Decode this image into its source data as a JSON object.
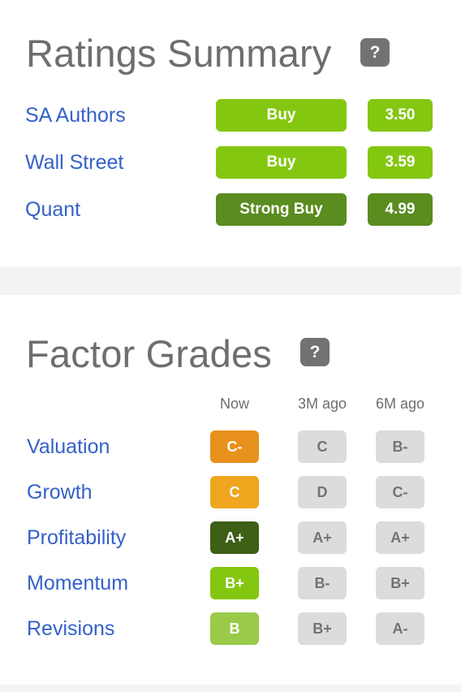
{
  "ratings_summary": {
    "title": "Ratings Summary",
    "help_icon": "question-icon",
    "rows": [
      {
        "label": "SA Authors",
        "rating": "Buy",
        "score": "3.50",
        "color": "#84c711"
      },
      {
        "label": "Wall Street",
        "rating": "Buy",
        "score": "3.59",
        "color": "#84c711"
      },
      {
        "label": "Quant",
        "rating": "Strong Buy",
        "score": "4.99",
        "color": "#5a8c1f"
      }
    ]
  },
  "factor_grades": {
    "title": "Factor Grades",
    "help_icon": "question-icon",
    "columns": [
      "Now",
      "3M ago",
      "6M ago"
    ],
    "rows": [
      {
        "label": "Valuation",
        "now": "C-",
        "now_color": "#e8911c",
        "m3": "C",
        "m6": "B-"
      },
      {
        "label": "Growth",
        "now": "C",
        "now_color": "#efa61e",
        "m3": "D",
        "m6": "C-"
      },
      {
        "label": "Profitability",
        "now": "A+",
        "now_color": "#3d5f16",
        "m3": "A+",
        "m6": "A+"
      },
      {
        "label": "Momentum",
        "now": "B+",
        "now_color": "#84c711",
        "m3": "B-",
        "m6": "B+"
      },
      {
        "label": "Revisions",
        "now": "B",
        "now_color": "#9aca4a",
        "m3": "B+",
        "m6": "A-"
      }
    ]
  },
  "colors": {
    "link": "#3461c9",
    "heading": "#6e6e6e",
    "historic_grade_bg": "#dcdcdc",
    "band": "#f2f3f5"
  }
}
